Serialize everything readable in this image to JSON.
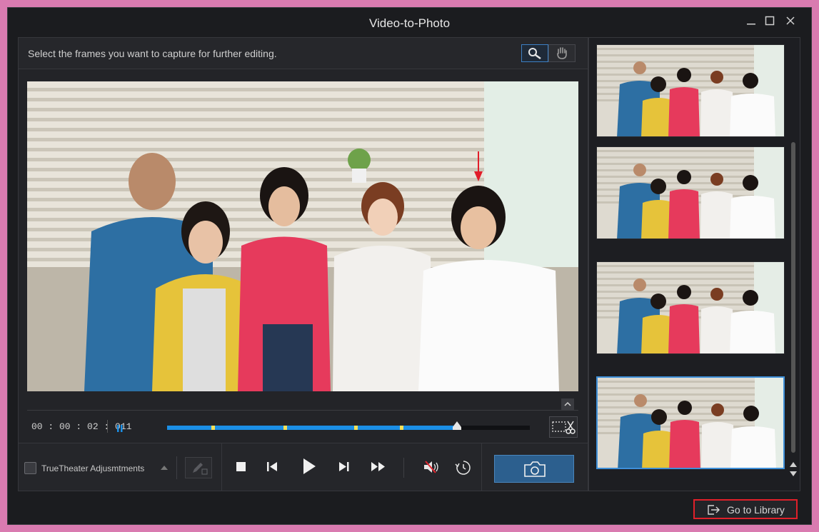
{
  "window": {
    "title": "Video-to-Photo"
  },
  "instructions": "Select the frames you want to capture for further editing.",
  "playback": {
    "timecode": "00 : 00 : 02 : 011",
    "progress": 0.8,
    "markers": [
      0.125,
      0.325,
      0.52,
      0.645
    ]
  },
  "controls": {
    "truetheater_label": "TrueTheater Adjusmtments",
    "truetheater_checked": false
  },
  "thumbnails": {
    "count": 4,
    "selected_index": 3
  },
  "footer": {
    "library_label": "Go to Library"
  },
  "colors": {
    "accent": "#1b8fe6",
    "marker": "#f2e05a",
    "highlight_border": "#e0202a",
    "capture_button": "#2c5f8e"
  },
  "icons": [
    "magnifier-icon",
    "hand-icon",
    "pause-icon",
    "scissors-icon",
    "pen-icon",
    "stop-icon",
    "previous-frame-icon",
    "play-icon",
    "next-frame-icon",
    "fast-forward-icon",
    "mute-icon",
    "timer-icon",
    "camera-icon",
    "export-icon"
  ]
}
